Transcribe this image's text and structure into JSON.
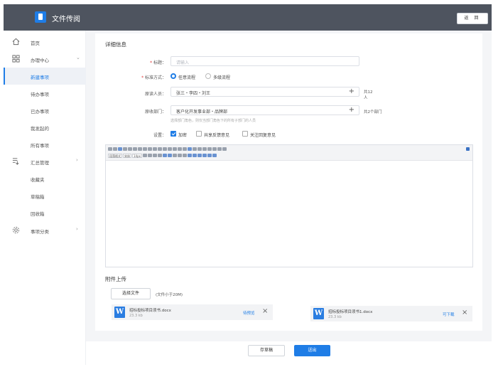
{
  "header": {
    "title": "文件传阅",
    "back_label": "返 回"
  },
  "sidebar": {
    "items": [
      {
        "label": "首页",
        "icon": "home-icon"
      },
      {
        "label": "办理中心",
        "icon": "grid-icon"
      },
      {
        "label": "新建事项",
        "active": true
      },
      {
        "label": "待办事项"
      },
      {
        "label": "已办事项"
      },
      {
        "label": "我发起的"
      },
      {
        "label": "所有事项"
      },
      {
        "label": "汇总管理",
        "icon": "summary-icon"
      },
      {
        "label": "收藏夹"
      },
      {
        "label": "草稿箱"
      },
      {
        "label": "回收箱"
      },
      {
        "label": "事项分类",
        "icon": "gear-icon"
      }
    ]
  },
  "form": {
    "section_title": "详细信息",
    "title_label": "标题：",
    "title_placeholder": "请输入",
    "flow_label": "标准方式：",
    "flow_options": [
      "任意流程",
      "多级流程"
    ],
    "readers_label": "原读人员：",
    "readers_value": "张三・李四・刘王",
    "readers_count": "共12人",
    "depts_label": "原收部门：",
    "depts_value": "客户化开发事业部・品牌部",
    "depts_count": "共2个部门",
    "depts_hint": "选择部门角色，则仅当部门角色下的所有子部门的人员",
    "settings_label": "设置：",
    "settings_options": [
      {
        "label": "加密",
        "checked": true
      },
      {
        "label": "共享反馈意见",
        "checked": false
      },
      {
        "label": "关注回复意见",
        "checked": false
      }
    ]
  },
  "editor": {
    "font_size": "14px",
    "font_name": "宋体",
    "style": "段落格式"
  },
  "attachments": {
    "section_title": "附件上传",
    "choose_label": "选择文件",
    "size_note": "(文件小于20M)",
    "files": [
      {
        "name": "招标投标项目须书.docx",
        "size": "23.3 kb",
        "action": "待预览"
      },
      {
        "name": "招标投标项目须书1.docx",
        "size": "23.3 kb",
        "action": "可下载"
      }
    ]
  },
  "footer": {
    "draft_label": "存草稿",
    "submit_label": "送出"
  },
  "colors": {
    "header_bg": "#4e545f",
    "accent": "#1f7de6",
    "word_icon": "#2a7de1"
  }
}
